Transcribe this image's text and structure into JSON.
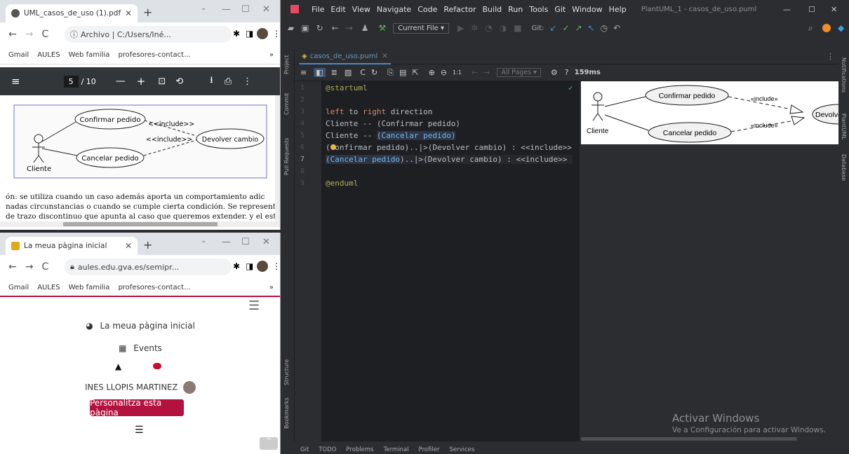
{
  "chrome_pdf": {
    "tab_title": "UML_casos_de_uso (1).pdf",
    "address": "Archivo | C:/Users/Iné...",
    "bookmarks": [
      "Gmail",
      "AULES",
      "Web familia",
      "profesores-contact..."
    ],
    "page_current": "5",
    "page_total": "/ 10",
    "diagram": {
      "use_case_1": "Confirmar pedido",
      "use_case_2": "Cancelar pedido",
      "use_case_3": "Devolver cambio",
      "include_1": "<<include>>",
      "include_2": "<<include>>",
      "actor": "Cliente"
    },
    "text_lines": [
      "ón: se utiliza cuando un caso además aporta un comportamiento adic",
      "nadas circunstancias o cuando se cumple cierta condición. Se representa",
      "de trazo discontinuo que apunta al caso que queremos extender. y el est"
    ]
  },
  "chrome_aules": {
    "tab_title": "La meua pàgina inicial",
    "address": "aules.edu.gva.es/semipr...",
    "bookmarks": [
      "Gmail",
      "AULES",
      "Web familia",
      "profesores-contact..."
    ],
    "home_link": "La meua pàgina inicial",
    "events_link": "Events",
    "user_name": "INES LLOPIS MARTINEZ",
    "customize_button": "Personalitza esta pàgina"
  },
  "ide": {
    "menu": [
      "File",
      "Edit",
      "View",
      "Navigate",
      "Code",
      "Refactor",
      "Build",
      "Run",
      "Tools",
      "Git",
      "Window",
      "Help"
    ],
    "window_title": "PlantUML_1 - casos_de_uso.puml",
    "run_config": "Current File",
    "git_label": "Git:",
    "file_tab": "casos_de_uso.puml",
    "all_pages": "All Pages",
    "render_time": "159ms",
    "help_mark": "?",
    "side_tools_left": [
      "Project",
      "Commit",
      "Pull Requests",
      "Structure",
      "Bookmarks"
    ],
    "side_tools_right": [
      "Notifications",
      "PlantUML",
      "Database"
    ],
    "line_numbers": [
      "1",
      "2",
      "3",
      "4",
      "5",
      "6",
      "7",
      "8",
      "9"
    ],
    "code": {
      "l1": "@startuml",
      "l3a": "left",
      "l3b": " to ",
      "l3c": "right",
      "l3d": " direction",
      "l4": "Cliente -- (Confirmar pedido)",
      "l5a": "Cliente -- ",
      "l5b": "(Cancelar pedido)",
      "l6": "(Confirmar pedido)..|>(Devolver cambio) : <<include>>",
      "l7a": "(Cancelar pedido",
      "l7b": ")..|>(Devolver cambio) : <<include>>",
      "l9": "@enduml"
    },
    "preview": {
      "use_case_1": "Confirmar pedido",
      "use_case_2": "Cancelar pedido",
      "use_case_3": "Devolve",
      "include_1": "«include»",
      "include_2": "«include»",
      "actor": "Cliente"
    },
    "watermark_title": "Activar Windows",
    "watermark_sub": "Ve a Configuración para activar Windows.",
    "status": [
      "Git",
      "TODO",
      "Problems",
      "Terminal",
      "Profiler",
      "Services"
    ]
  }
}
